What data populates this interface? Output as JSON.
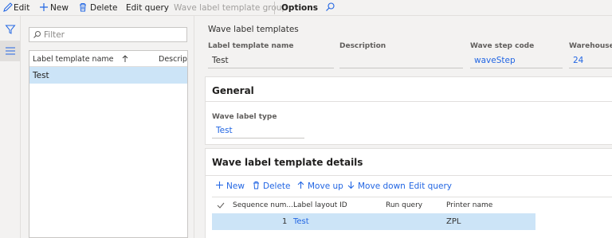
{
  "toolbar": {
    "edit_label": "Edit",
    "new_label": "New",
    "delete_label": "Delete",
    "edit_query_label": "Edit query",
    "template_group_label": "Wave label template group",
    "options_label": "Options"
  },
  "list": {
    "filter_placeholder": "Filter",
    "columns": [
      "Label template name",
      "Descrip"
    ],
    "rows": [
      {
        "name": "Test"
      }
    ]
  },
  "detail": {
    "section_title": "Wave label templates",
    "fields": {
      "label_template_name": {
        "label": "Label template name",
        "value": "Test"
      },
      "description": {
        "label": "Description",
        "value": ""
      },
      "wave_step_code": {
        "label": "Wave step code",
        "value": "waveStep"
      },
      "warehouse": {
        "label": "Warehouse",
        "value": "24"
      }
    },
    "general": {
      "title": "General",
      "wave_label_type": {
        "label": "Wave label type",
        "value": "Test"
      }
    },
    "template_details": {
      "title": "Wave label template details",
      "actions": {
        "new": "New",
        "delete": "Delete",
        "move_up": "Move up",
        "move_down": "Move down",
        "edit_query": "Edit query"
      },
      "columns": [
        "Sequence num...",
        "Label layout ID",
        "Run query",
        "Printer name"
      ],
      "rows": [
        {
          "sequence": "1",
          "layout_id": "Test",
          "run_query": "",
          "printer": "ZPL"
        }
      ]
    }
  },
  "colors": {
    "accent": "#2266e3",
    "selection": "#cce4f7"
  }
}
